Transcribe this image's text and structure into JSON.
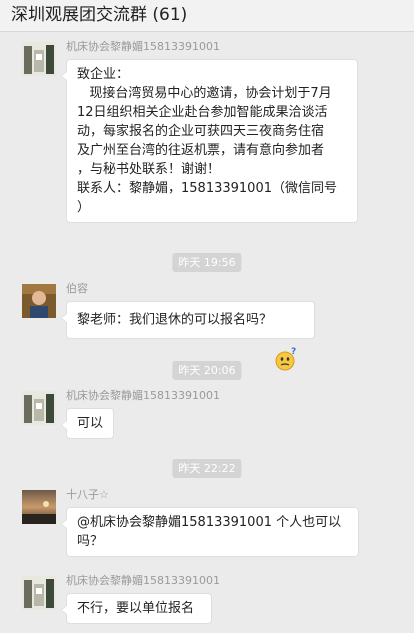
{
  "header": {
    "title": "深圳观展团交流群 (61)"
  },
  "messages": [
    {
      "sender": "机床协会黎静媚15813391001",
      "lines": [
        "致企业：",
        "   现接台湾贸易中心的邀请，协会计划于7月",
        "12日组织相关企业赴台参加智能成果洽谈活",
        "动，每家报名的企业可获四天三夜商务住宿",
        "及广州至台湾的往返机票，请有意向参加者",
        "，与秘书处联系！谢谢！",
        "联系人：黎静媚，15813391001（微信同号",
        "）"
      ]
    },
    {
      "time": "昨天 19:56"
    },
    {
      "sender": "伯容",
      "lines": [
        "黎老师：我们退休的可以报名吗？"
      ],
      "emoji": "confused-face-emoji"
    },
    {
      "time": "昨天 20:06"
    },
    {
      "sender": "机床协会黎静媚15813391001",
      "lines": [
        "可以"
      ]
    },
    {
      "time": "昨天 22:22"
    },
    {
      "sender": "十八子☆",
      "lines": [
        "@机床协会黎静媚15813391001 个人也可以",
        "吗？"
      ]
    },
    {
      "sender": "机床协会黎静媚15813391001",
      "lines": [
        "不行，要以单位报名"
      ]
    }
  ]
}
